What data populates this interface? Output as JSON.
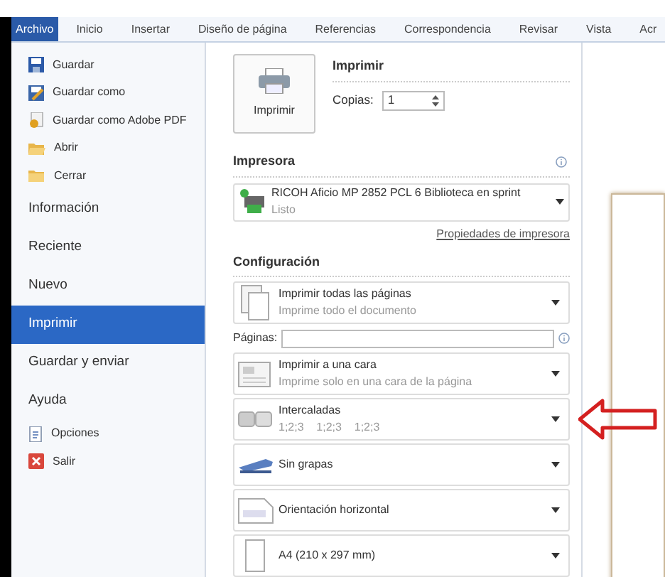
{
  "tabs": [
    {
      "label": "Archivo",
      "selected": true
    },
    {
      "label": "Inicio",
      "selected": false
    },
    {
      "label": "Insertar",
      "selected": false
    },
    {
      "label": "Diseño de página",
      "selected": false
    },
    {
      "label": "Referencias",
      "selected": false
    },
    {
      "label": "Correspondencia",
      "selected": false
    },
    {
      "label": "Revisar",
      "selected": false
    },
    {
      "label": "Vista",
      "selected": false
    },
    {
      "label": "Acr",
      "selected": false
    }
  ],
  "sidebar": {
    "items": [
      {
        "kind": "command",
        "label": "Guardar",
        "selected": false
      },
      {
        "kind": "command",
        "label": "Guardar como",
        "selected": false
      },
      {
        "kind": "command",
        "label": "Guardar como Adobe PDF",
        "selected": false
      },
      {
        "kind": "command",
        "label": "Abrir",
        "selected": false
      },
      {
        "kind": "command",
        "label": "Cerrar",
        "selected": false
      },
      {
        "kind": "section",
        "label": "Información",
        "selected": false
      },
      {
        "kind": "section",
        "label": "Reciente",
        "selected": false
      },
      {
        "kind": "section",
        "label": "Nuevo",
        "selected": false
      },
      {
        "kind": "section",
        "label": "Imprimir",
        "selected": true
      },
      {
        "kind": "section",
        "label": "Guardar y enviar",
        "selected": false
      },
      {
        "kind": "section",
        "label": "Ayuda",
        "selected": false
      },
      {
        "kind": "command",
        "label": "Opciones",
        "selected": false
      },
      {
        "kind": "command",
        "label": "Salir",
        "selected": false
      }
    ]
  },
  "print": {
    "button_label": "Imprimir",
    "heading": "Imprimir",
    "copies_label": "Copias:",
    "copies_value": "1"
  },
  "printer": {
    "heading": "Impresora",
    "name": "RICOH Aficio MP 2852 PCL 6 Biblioteca en sprint",
    "status": "Listo",
    "properties_link": "Propiedades de impresora"
  },
  "settings": {
    "heading": "Configuración",
    "items": [
      {
        "kind": "dropdown",
        "title": "Imprimir todas las páginas",
        "subtitle": "Imprime todo el documento"
      },
      {
        "kind": "pages_field",
        "label": "Páginas:"
      },
      {
        "kind": "dropdown",
        "title": "Imprimir a una cara",
        "subtitle": "Imprime solo en una cara de la página"
      },
      {
        "kind": "dropdown",
        "title": "Intercaladas",
        "subtitle": "1;2;3    1;2;3    1;2;3"
      },
      {
        "kind": "dropdown",
        "title": "Sin grapas"
      },
      {
        "kind": "dropdown",
        "title": "Orientación horizontal"
      },
      {
        "kind": "dropdown",
        "title": "A4 (210 x 297 mm)"
      }
    ]
  }
}
